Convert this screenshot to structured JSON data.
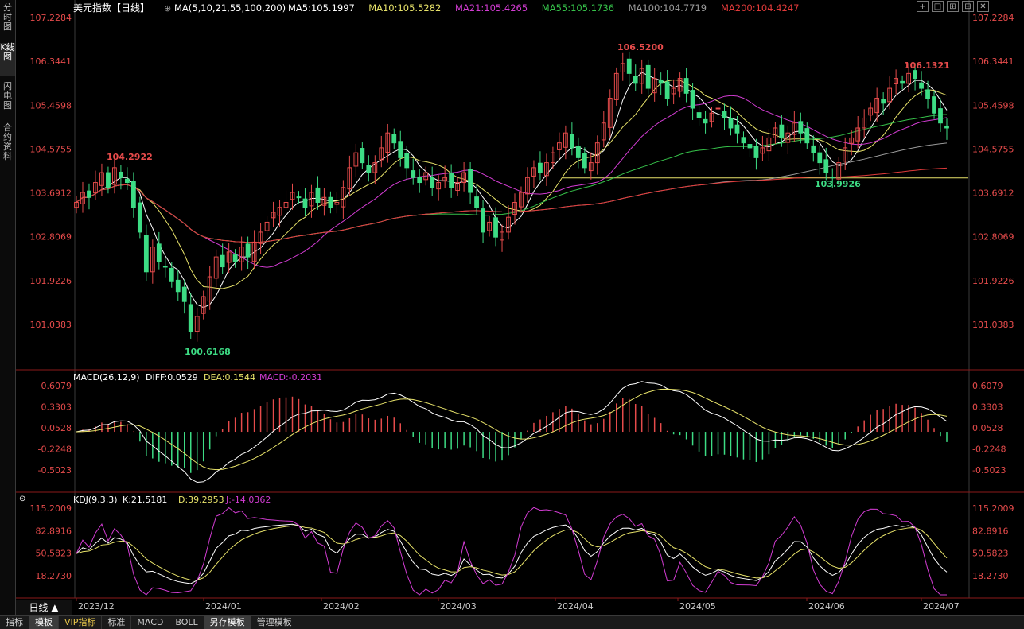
{
  "sidebar": {
    "tabs": [
      "分时图",
      "K线图",
      "闪电图",
      "合约资料"
    ]
  },
  "header": {
    "title": "美元指数【日线】",
    "ma_label": "MA(5,10,21,55,100,200)",
    "ma": [
      {
        "text": "MA5:105.1997",
        "color": "#ffffff"
      },
      {
        "text": "MA10:105.5282",
        "color": "#e8e36a"
      },
      {
        "text": "MA21:105.4265",
        "color": "#d23cd2"
      },
      {
        "text": "MA55:105.1736",
        "color": "#36c24a"
      },
      {
        "text": "MA100:104.7719",
        "color": "#9a9a9a"
      },
      {
        "text": "MA200:104.4247",
        "color": "#e03a3a"
      }
    ]
  },
  "window_buttons": [
    "+",
    "□",
    "⊞",
    "⊟",
    "✕"
  ],
  "price_axis": [
    "107.2284",
    "106.3441",
    "105.4598",
    "104.5755",
    "103.6912",
    "102.8069",
    "101.9226",
    "101.0383"
  ],
  "annotations": {
    "high1": "106.5200",
    "high2": "106.1321",
    "low1": "100.6168",
    "low2": "103.9926",
    "mid": "104.2922"
  },
  "macd": {
    "label": "MACD(26,12,9)",
    "diff": "DIFF:0.0529",
    "dea": "DEA:0.1544",
    "macd": "MACD:-0.2031",
    "axis": [
      "0.6079",
      "0.3303",
      "0.0528",
      "-0.2248",
      "-0.5023"
    ]
  },
  "kdj": {
    "label": "KDJ(9,3,3)",
    "k": "K:21.5181",
    "d": "D:39.2953",
    "j": "J:-14.0362",
    "axis": [
      "115.2009",
      "82.8916",
      "50.5823",
      "18.2730"
    ]
  },
  "x_axis": [
    "2023/12",
    "2024/01",
    "2024/02",
    "2024/03",
    "2024/04",
    "2024/05",
    "2024/06",
    "2024/07"
  ],
  "period": "日线",
  "footer_tabs": [
    "指标",
    "模板",
    "VIP指标",
    "标准",
    "MACD",
    "BOLL",
    "另存模板",
    "管理模板"
  ],
  "colors": {
    "up": "#e64b4b",
    "down": "#3ddc84",
    "diff": "#ffffff",
    "dea": "#e8e36a",
    "j": "#d23cd2",
    "support": "#e8e36a"
  },
  "support_level": 103.9926,
  "chart_data": {
    "type": "candlestick",
    "closes": [
      103.5,
      103.7,
      103.6,
      103.9,
      104.1,
      103.8,
      104.2,
      104.0,
      103.9,
      103.4,
      102.9,
      102.1,
      102.6,
      102.3,
      102.2,
      101.9,
      101.7,
      101.5,
      100.9,
      101.2,
      101.6,
      102.0,
      102.4,
      102.2,
      102.5,
      102.3,
      102.6,
      102.4,
      102.7,
      102.9,
      103.1,
      103.3,
      103.4,
      103.5,
      103.7,
      103.6,
      103.4,
      103.7,
      103.5,
      103.6,
      103.4,
      103.5,
      103.8,
      104.2,
      104.5,
      104.3,
      104.1,
      104.3,
      104.6,
      104.9,
      104.7,
      104.4,
      104.2,
      104.0,
      103.9,
      104.1,
      103.8,
      103.9,
      104.0,
      103.8,
      103.9,
      104.1,
      103.7,
      103.4,
      102.9,
      103.1,
      102.8,
      102.9,
      103.2,
      103.5,
      103.7,
      104.0,
      104.2,
      104.1,
      104.3,
      104.5,
      104.7,
      104.9,
      104.6,
      104.4,
      104.2,
      104.3,
      104.7,
      105.1,
      105.6,
      106.1,
      106.3,
      106.1,
      105.9,
      106.2,
      105.8,
      106.0,
      105.9,
      105.6,
      105.8,
      106.0,
      105.7,
      105.4,
      105.2,
      105.1,
      105.3,
      105.4,
      105.2,
      105.0,
      104.9,
      104.7,
      104.6,
      104.4,
      104.6,
      104.8,
      105.0,
      104.8,
      104.9,
      105.1,
      104.9,
      104.7,
      104.5,
      104.3,
      104.1,
      104.0,
      104.3,
      104.6,
      104.8,
      105.0,
      105.2,
      105.4,
      105.6,
      105.5,
      105.8,
      106.0,
      105.9,
      106.1,
      106.0,
      105.8,
      105.6,
      105.3,
      105.1,
      105.0
    ],
    "x_ticks": [
      "2023/12",
      "2024/01",
      "2024/02",
      "2024/03",
      "2024/04",
      "2024/05",
      "2024/06",
      "2024/07"
    ],
    "price_range": [
      100.6,
      107.2284
    ],
    "macd_range": [
      -0.6,
      0.7
    ],
    "kdj_range": [
      -10,
      125
    ]
  }
}
